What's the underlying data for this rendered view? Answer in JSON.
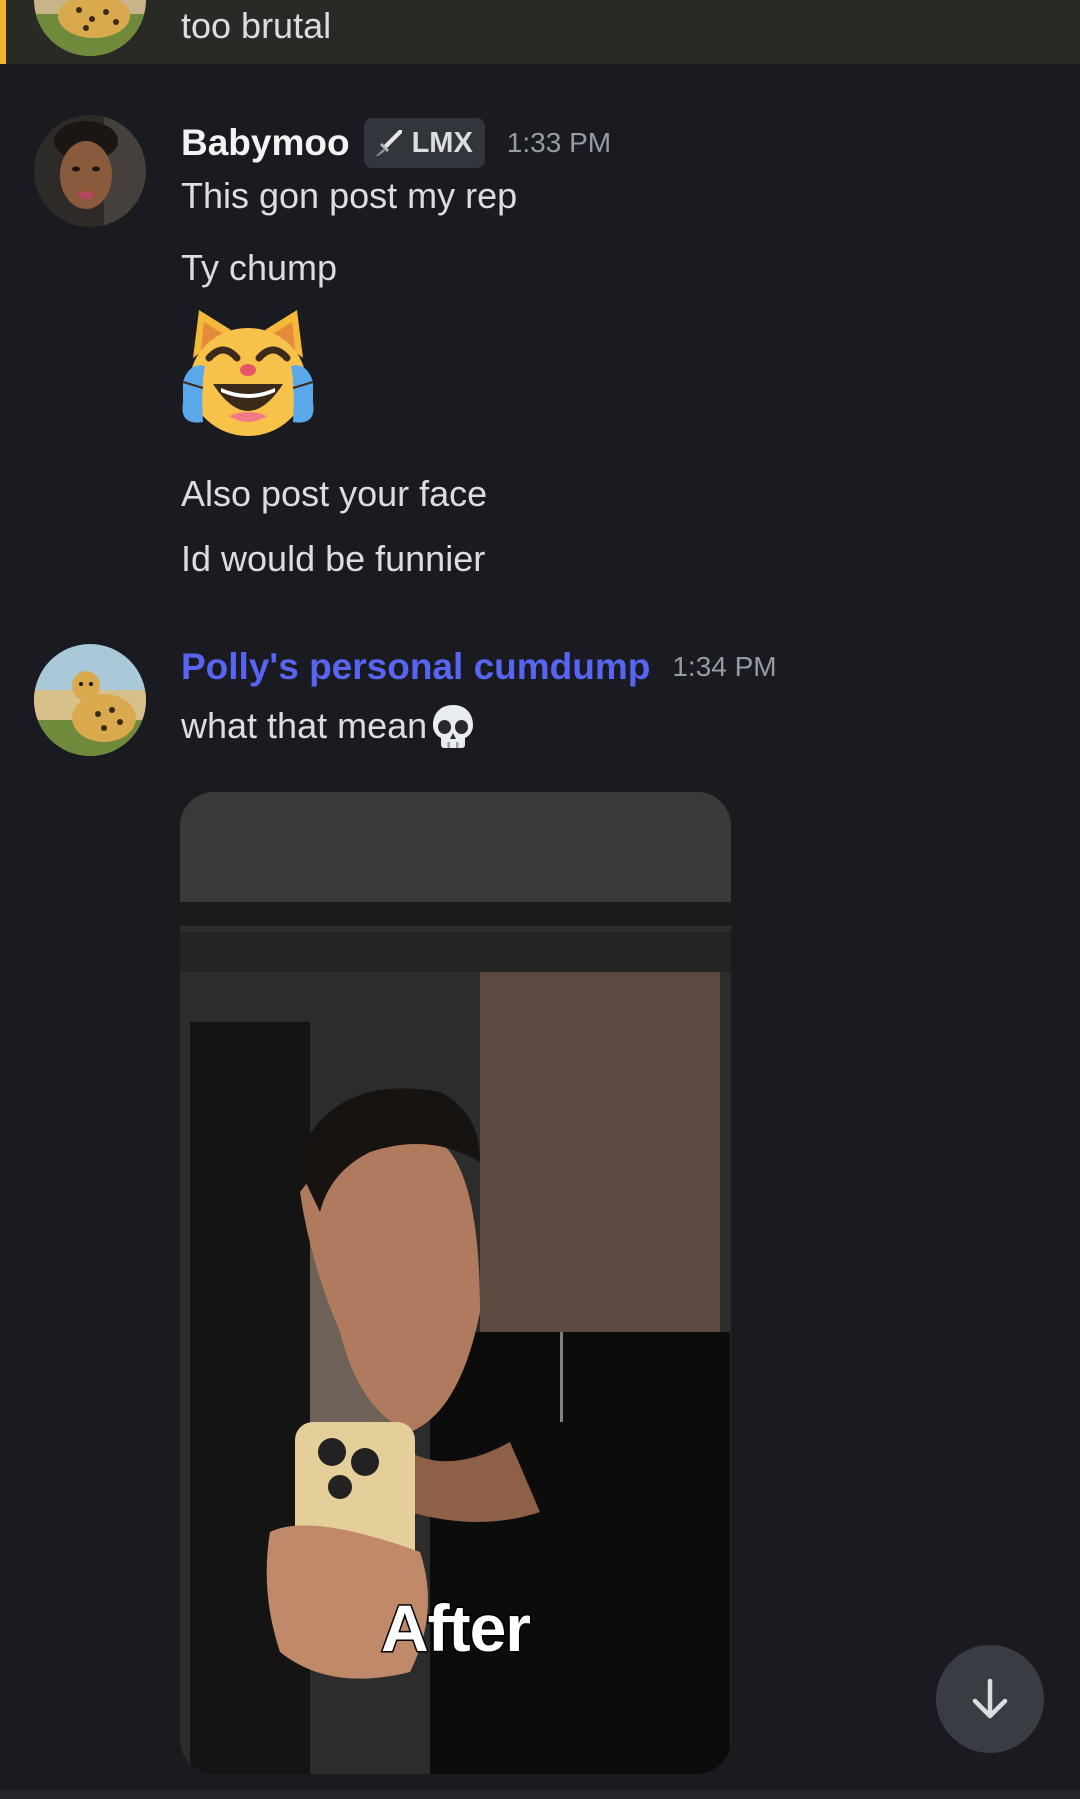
{
  "top_message": {
    "text": "too brutal"
  },
  "messages": [
    {
      "username": "Babymoo",
      "tag": "LMX",
      "timestamp": "1:33 PM",
      "lines": [
        "This gon post my rep",
        "Ty chump",
        "Also post your face",
        "Id would be funnier"
      ],
      "jumbo_emoji": "cat-face-with-tears-of-joy"
    },
    {
      "username": "Polly's personal cumdump",
      "timestamp": "1:34 PM",
      "text": "what that mean",
      "inline_emoji": "skull",
      "attachment": {
        "caption": "After"
      }
    }
  ],
  "colors": {
    "background": "#1a1b20",
    "mention_highlight": "#2b2925",
    "mention_bar": "#f0b232",
    "username_blurple": "#5865f2",
    "timestamp": "#949ba4"
  },
  "jump_button": {
    "icon": "arrow-down-icon"
  }
}
